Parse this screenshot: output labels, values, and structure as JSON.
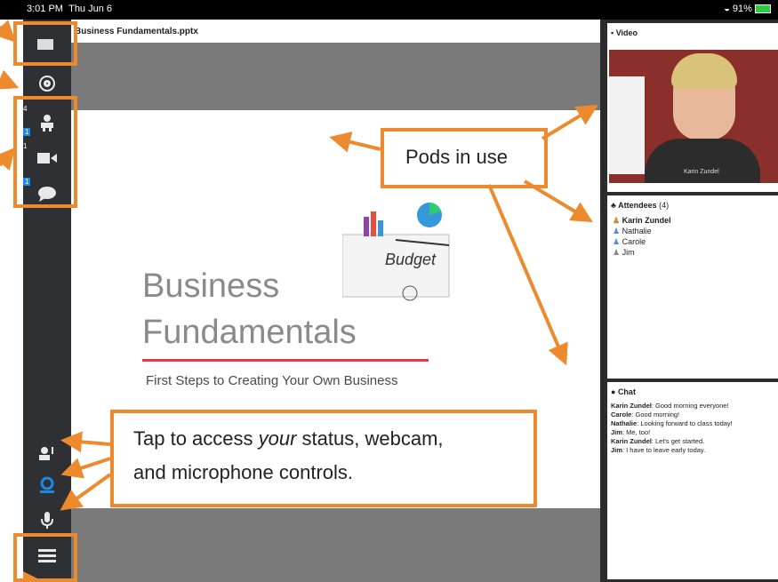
{
  "statusbar": {
    "time": "3:01 PM",
    "date": "Thu Jun 6",
    "battery": "91%"
  },
  "content": {
    "file_title": "Business Fundamentals.pptx"
  },
  "slide": {
    "title_line1": "Business",
    "title_line2": "Fundamentals",
    "subtitle": "First Steps to Creating Your Own Business",
    "graphic_text": "Budget"
  },
  "sidebar": {
    "badges": {
      "attendees": "4",
      "attendees_new": "1",
      "video": "1",
      "video_new": "1",
      "chat_new": "1"
    }
  },
  "video_pod": {
    "title": "Video",
    "name_overlay": "Karin Zundel"
  },
  "attendees_pod": {
    "title": "Attendees",
    "count": "(4)",
    "list": [
      "Karin Zundel",
      "Nathalie",
      "Carole",
      "Jim"
    ]
  },
  "chat_pod": {
    "title": "Chat",
    "messages": [
      {
        "sender": "Karin Zundel",
        "text": ": Good morning everyone!"
      },
      {
        "sender": "Carole",
        "text": ": Good morning!"
      },
      {
        "sender": "Nathalie",
        "text": ": Looking forward to class today!"
      },
      {
        "sender": "Jim",
        "text": ": Me, too!"
      },
      {
        "sender": "Karin Zundel",
        "text": ": Let's get started."
      },
      {
        "sender": "Jim",
        "text": ": I have to leave early today."
      }
    ]
  },
  "callouts": {
    "pods": "Pods in use",
    "status_pre": "Tap to access ",
    "status_em": "your",
    "status_post": " status, webcam,",
    "status_line2": "and microphone controls."
  },
  "colors": {
    "accent": "#ed8a2e",
    "sidebar": "#2f3033",
    "underline": "#e03b4b",
    "active_icon": "#1e88e5"
  }
}
